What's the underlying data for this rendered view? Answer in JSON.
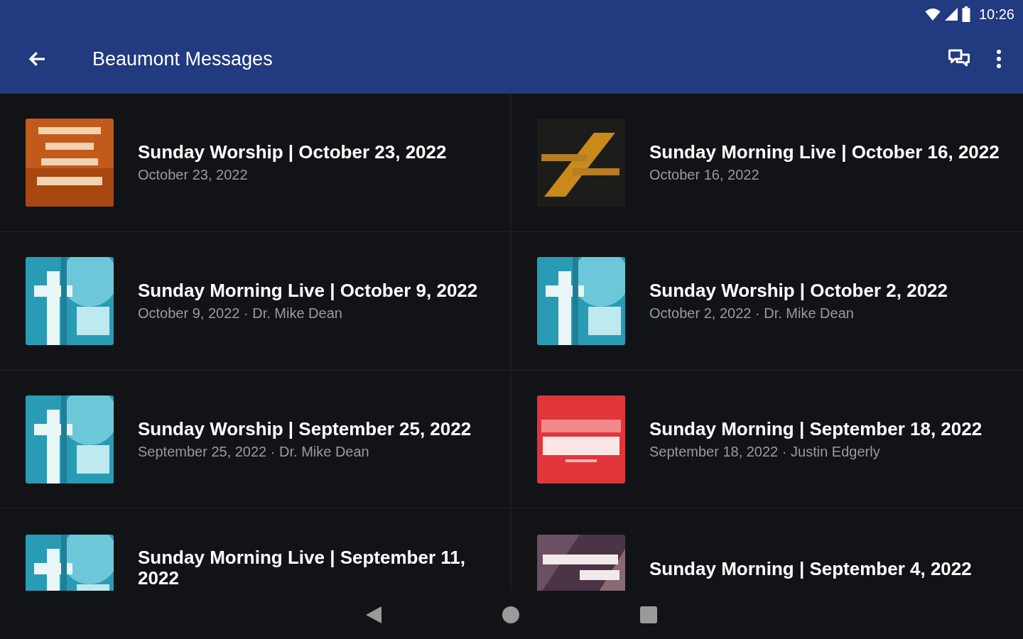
{
  "status_bar": {
    "time": "10:26"
  },
  "app_bar": {
    "title": "Beaumont Messages"
  },
  "messages": [
    {
      "kind": "picture",
      "title": "Sunday Worship | October 23, 2022",
      "subtitle": "October 23, 2022"
    },
    {
      "kind": "picture",
      "title": "Sunday Morning Live | October 16, 2022",
      "subtitle": "October 16, 2022"
    },
    {
      "kind": "picture",
      "title": "Sunday Morning Live | October 9, 2022",
      "subtitle": "October 9, 2022 · Dr. Mike Dean"
    },
    {
      "kind": "picture",
      "title": "Sunday Worship | October 2, 2022",
      "subtitle": "October 2, 2022 · Dr. Mike Dean"
    },
    {
      "kind": "picture",
      "title": "Sunday Worship | September 25, 2022",
      "subtitle": "September 25, 2022 · Dr. Mike Dean"
    },
    {
      "kind": "picture",
      "title": "Sunday Morning | September 18, 2022",
      "subtitle": "September 18, 2022 · Justin Edgerly"
    },
    {
      "kind": "picture",
      "title": "Sunday Morning Live | September 11, 2022"
    },
    {
      "kind": "picture",
      "title": "Sunday Morning | September 4, 2022"
    }
  ]
}
